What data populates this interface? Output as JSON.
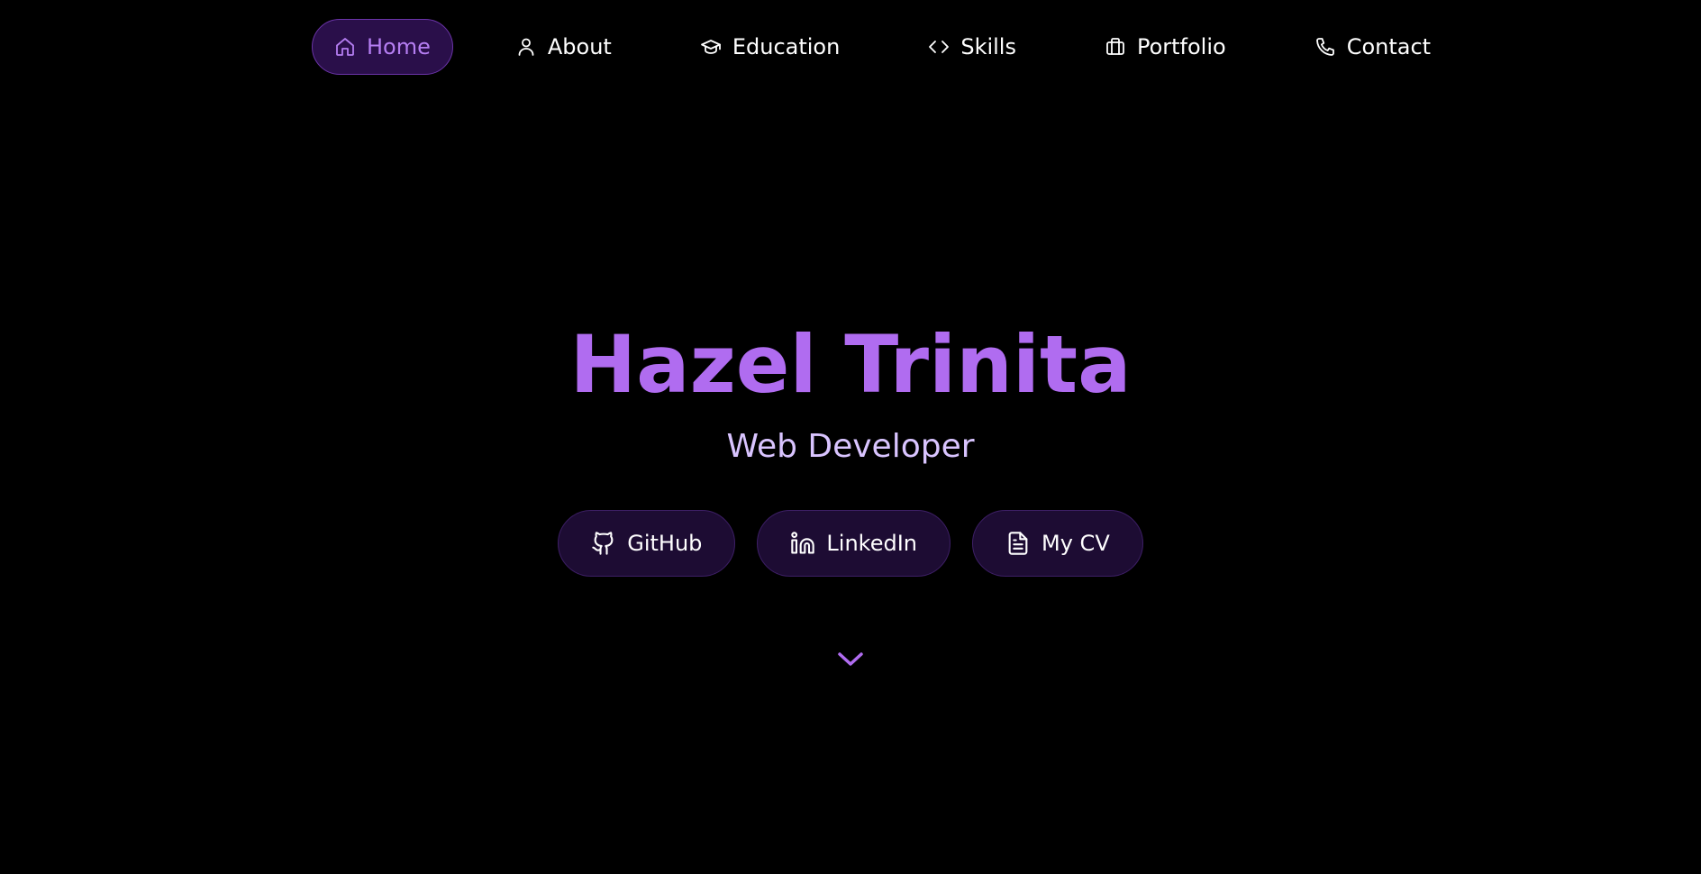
{
  "colors": {
    "background": "#000000",
    "accent": "#b06cf0",
    "active_nav_bg": "#2a0f4a",
    "button_bg": "#1d0c33",
    "role_text": "#d9c4ff"
  },
  "nav": {
    "items": [
      {
        "label": "Home",
        "icon": "home-icon",
        "active": true
      },
      {
        "label": "About",
        "icon": "user-icon",
        "active": false
      },
      {
        "label": "Education",
        "icon": "graduation-cap-icon",
        "active": false
      },
      {
        "label": "Skills",
        "icon": "code-icon",
        "active": false
      },
      {
        "label": "Portfolio",
        "icon": "briefcase-icon",
        "active": false
      },
      {
        "label": "Contact",
        "icon": "phone-icon",
        "active": false
      }
    ]
  },
  "hero": {
    "name": "Hazel Trinita",
    "role": "Web Developer",
    "buttons": [
      {
        "label": "GitHub",
        "icon": "github-icon"
      },
      {
        "label": "LinkedIn",
        "icon": "linkedin-icon"
      },
      {
        "label": "My CV",
        "icon": "document-icon"
      }
    ],
    "scroll_icon": "chevron-down-icon"
  }
}
